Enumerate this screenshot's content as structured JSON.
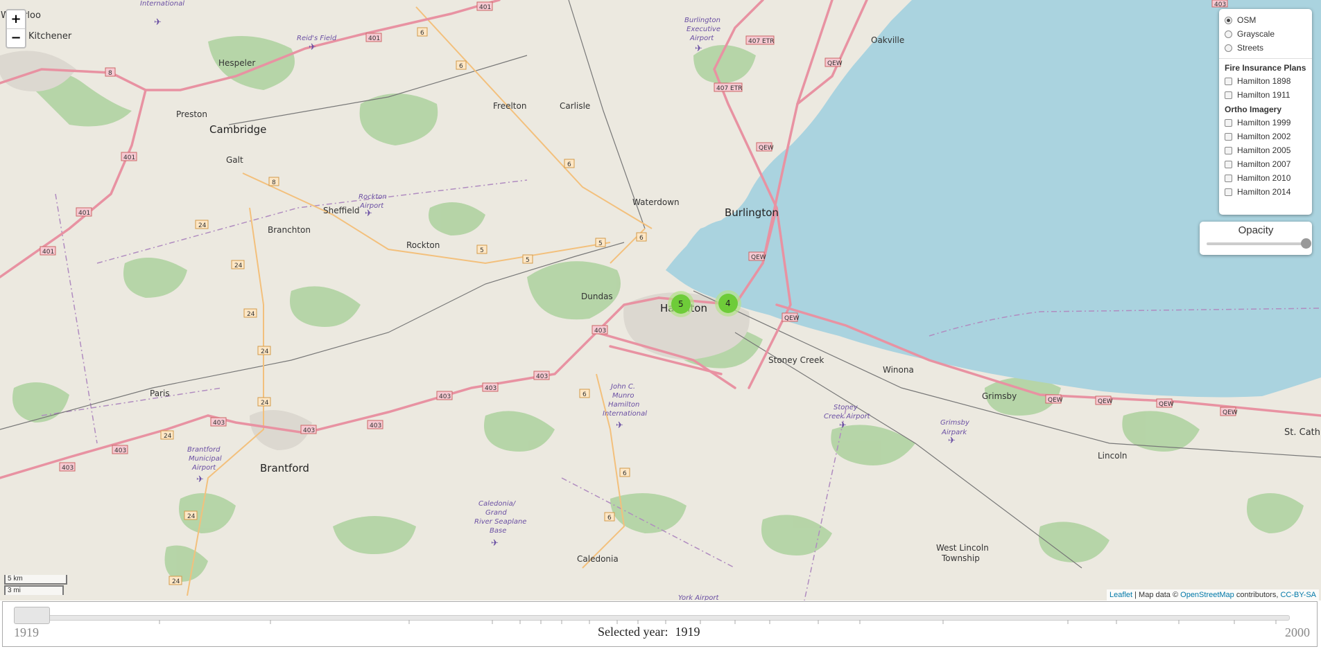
{
  "map": {
    "places": {
      "waterloo": "Waterloo",
      "kitchener": "Kitchener",
      "cambridge": "Cambridge",
      "hespeler": "Hespeler",
      "preston": "Preston",
      "galt": "Galt",
      "branchton": "Branchton",
      "sheffield": "Sheffield",
      "rockton": "Rockton",
      "freelton": "Freelton",
      "carlisle": "Carlisle",
      "waterdown": "Waterdown",
      "burlington": "Burlington",
      "oakville": "Oakville",
      "dundas": "Dundas",
      "hamilton": "Hamilton",
      "stoney_creek": "Stoney Creek",
      "winona": "Winona",
      "grimsby": "Grimsby",
      "paris": "Paris",
      "brantford": "Brantford",
      "lincoln": "Lincoln",
      "west_lincoln_1": "West Lincoln",
      "west_lincoln_2": "Township",
      "caledonia": "Caledonia",
      "st_cath": "St. Cath"
    },
    "airports": {
      "waterloo_intl": "International",
      "reids_field": "Reid's Field",
      "burlington_exec_1": "Burlington",
      "burlington_exec_2": "Executive",
      "burlington_exec_3": "Airport",
      "rockton_1": "Rockton",
      "rockton_2": "Airport",
      "hamilton_intl_1": "John C.",
      "hamilton_intl_2": "Munro",
      "hamilton_intl_3": "Hamilton",
      "hamilton_intl_4": "International",
      "stoney_1": "Stoney",
      "stoney_2": "Creek Airport",
      "grimsby_1": "Grimsby",
      "grimsby_2": "Airpark",
      "brantford_1": "Brantford",
      "brantford_2": "Municipal",
      "brantford_3": "Airport",
      "caledonia_1": "Caledonia/",
      "caledonia_2": "Grand",
      "caledonia_3": "River Seaplane",
      "caledonia_4": "Base",
      "york": "York Airport"
    },
    "clusters": [
      {
        "label": "5"
      },
      {
        "label": "4"
      }
    ],
    "colors": {
      "water": "#aad3df",
      "land": "#ece9e0",
      "wood": "#add19e",
      "highway": "#e892a2",
      "primary": "#fcd6a4",
      "cluster": "#8fd15d"
    }
  },
  "zoom": {
    "in": "+",
    "out": "−"
  },
  "layers": {
    "base": [
      {
        "label": "OSM",
        "selected": true
      },
      {
        "label": "Grayscale",
        "selected": false
      },
      {
        "label": "Streets",
        "selected": false
      }
    ],
    "fire_title": "Fire Insurance Plans",
    "fire": [
      {
        "label": "Hamilton 1898"
      },
      {
        "label": "Hamilton 1911"
      }
    ],
    "ortho_title": "Ortho Imagery",
    "ortho": [
      {
        "label": "Hamilton 1999"
      },
      {
        "label": "Hamilton 2002"
      },
      {
        "label": "Hamilton 2005"
      },
      {
        "label": "Hamilton 2007"
      },
      {
        "label": "Hamilton 2010"
      },
      {
        "label": "Hamilton 2014"
      }
    ]
  },
  "opacity": {
    "label": "Opacity",
    "value": 1.0
  },
  "scale": {
    "km": "5 km",
    "mi": "3 mi"
  },
  "attribution": {
    "leaflet": "Leaflet",
    "mid": " | Map data © ",
    "osm": "OpenStreetMap",
    "contrib": " contributors, ",
    "license": "CC-BY-SA"
  },
  "timeline": {
    "min": "1919",
    "max": "2000",
    "selected_label": "Selected year:",
    "selected_value": "1919",
    "value": 1919
  }
}
